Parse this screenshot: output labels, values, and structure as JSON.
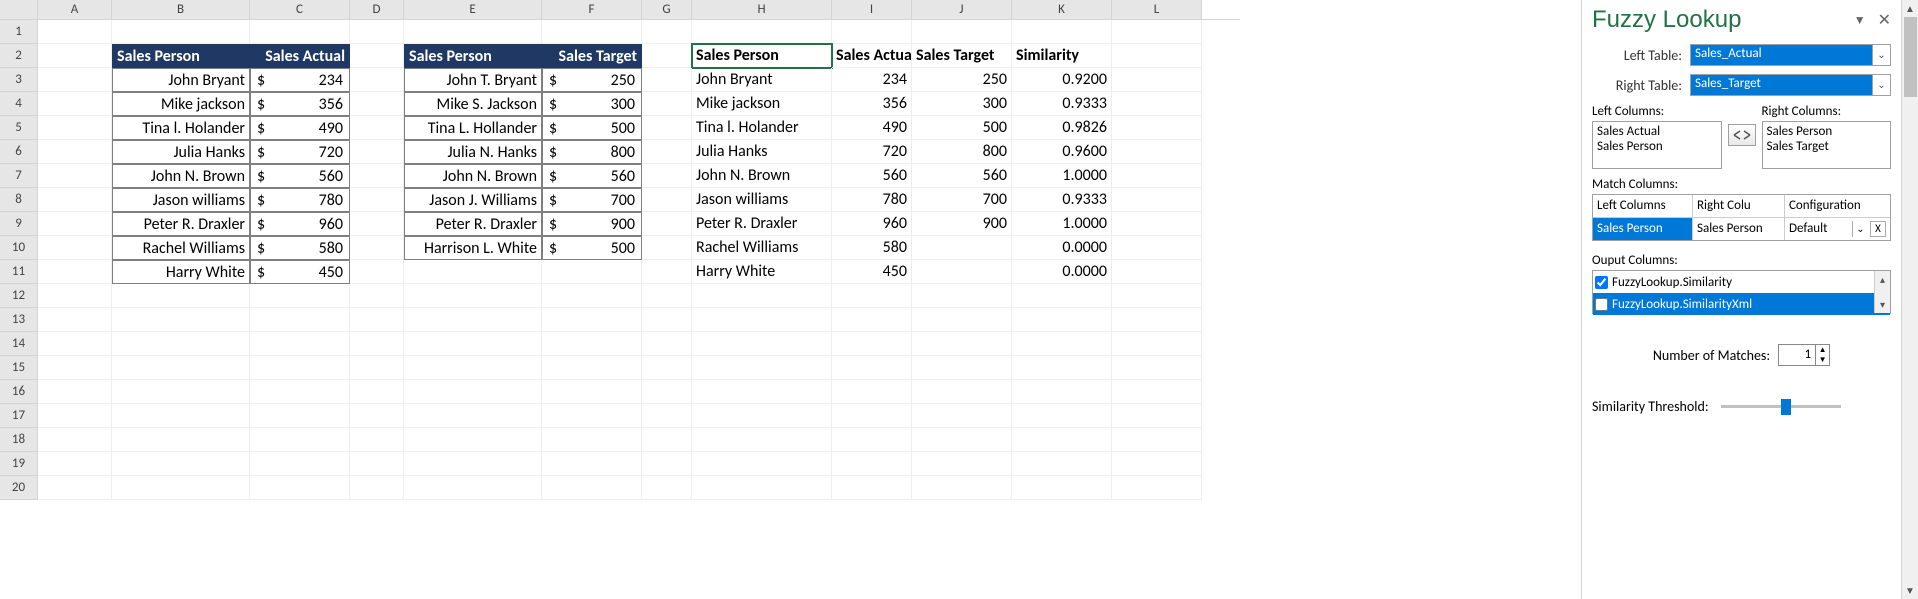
{
  "columns": [
    "A",
    "B",
    "C",
    "D",
    "E",
    "F",
    "G",
    "H",
    "I",
    "J",
    "K",
    "L"
  ],
  "row_count": 20,
  "active_cell": "H2",
  "table1": {
    "headers": [
      "Sales Person",
      "Sales Actual"
    ],
    "rows": [
      {
        "name": "John Bryant",
        "val": "234"
      },
      {
        "name": "Mike jackson",
        "val": "356"
      },
      {
        "name": "Tina l. Holander",
        "val": "490"
      },
      {
        "name": "Julia Hanks",
        "val": "720"
      },
      {
        "name": "John  N. Brown",
        "val": "560"
      },
      {
        "name": "Jason williams",
        "val": "780"
      },
      {
        "name": "Peter R. Draxler",
        "val": "960"
      },
      {
        "name": "Rachel Williams",
        "val": "580"
      },
      {
        "name": "Harry White",
        "val": "450"
      }
    ]
  },
  "table2": {
    "headers": [
      "Sales Person",
      "Sales Target"
    ],
    "rows": [
      {
        "name": "John T. Bryant",
        "val": "250"
      },
      {
        "name": "Mike S. Jackson",
        "val": "300"
      },
      {
        "name": "Tina L. Hollander",
        "val": "500"
      },
      {
        "name": "Julia N. Hanks",
        "val": "800"
      },
      {
        "name": "John N. Brown",
        "val": "560"
      },
      {
        "name": "Jason J. Williams",
        "val": "700"
      },
      {
        "name": "Peter R. Draxler",
        "val": "900"
      },
      {
        "name": "Harrison L. White",
        "val": "500"
      }
    ]
  },
  "results": {
    "headers": [
      "Sales Person",
      "Sales Actual",
      "Sales Target",
      "Similarity"
    ],
    "header_display": [
      "Sales Person",
      "Sales Actua",
      "Sales Target",
      "Similarity"
    ],
    "rows": [
      {
        "name": "John Bryant",
        "actual": "234",
        "target": "250",
        "sim": "0.9200"
      },
      {
        "name": "Mike jackson",
        "actual": "356",
        "target": "300",
        "sim": "0.9333"
      },
      {
        "name": "Tina l. Holander",
        "actual": "490",
        "target": "500",
        "sim": "0.9826"
      },
      {
        "name": "Julia Hanks",
        "actual": "720",
        "target": "800",
        "sim": "0.9600"
      },
      {
        "name": "John  N. Brown",
        "actual": "560",
        "target": "560",
        "sim": "1.0000"
      },
      {
        "name": "Jason williams",
        "actual": "780",
        "target": "700",
        "sim": "0.9333"
      },
      {
        "name": "Peter R. Draxler",
        "actual": "960",
        "target": "900",
        "sim": "1.0000"
      },
      {
        "name": "Rachel Williams",
        "actual": "580",
        "target": "",
        "sim": "0.0000"
      },
      {
        "name": "Harry White",
        "actual": "450",
        "target": "",
        "sim": "0.0000"
      }
    ]
  },
  "pane": {
    "title": "Fuzzy Lookup",
    "left_table_label": "Left Table:",
    "right_table_label": "Right Table:",
    "left_table_value": "Sales_Actual",
    "right_table_value": "Sales_Target",
    "left_cols_label": "Left Columns:",
    "right_cols_label": "Right Columns:",
    "left_cols": [
      "Sales Actual",
      "Sales Person"
    ],
    "right_cols": [
      "Sales Person",
      "Sales Target"
    ],
    "match_label": "Match Columns:",
    "match_headers": [
      "Left Columns",
      "Right Colu",
      "Configuration"
    ],
    "match_row": {
      "left": "Sales Person",
      "right": "Sales Person",
      "config": "Default"
    },
    "output_label": "Ouput Columns:",
    "output_items": [
      "FuzzyLookup.Similarity",
      "FuzzyLookup.SimilarityXml"
    ],
    "output_checked": [
      true,
      false
    ],
    "num_label": "Number of Matches:",
    "num_value": "1",
    "sim_thresh_label": "Similarity Threshold:",
    "currency_symbol": "$"
  }
}
